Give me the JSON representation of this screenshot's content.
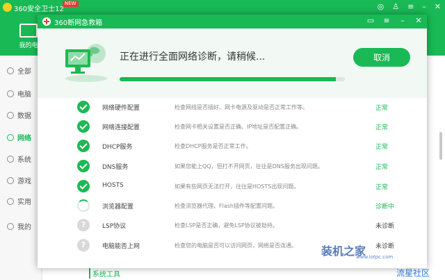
{
  "app": {
    "title": "360安全卫士12",
    "new_badge": "NEW",
    "top_tab": "我的电",
    "sidebar": [
      {
        "label": "全部"
      },
      {
        "label": "电脑"
      },
      {
        "label": "数据"
      },
      {
        "label": "网络"
      },
      {
        "label": "系统"
      },
      {
        "label": "游戏"
      },
      {
        "label": "实用"
      },
      {
        "label": "我的"
      }
    ],
    "bottom_section": "系统工具"
  },
  "dialog": {
    "title": "360断网急救箱",
    "status_text": "正在进行全面网络诊断，请稍候...",
    "progress": 0.96,
    "cancel_label": "取消",
    "rows": [
      {
        "name": "网络硬件配置",
        "desc": "检查网线是否插好、网卡电源及驱动是否正常工作等。",
        "result": "正常",
        "state": "ok"
      },
      {
        "name": "网络连接配置",
        "desc": "检查网卡相关设置是否正确、IP地址是否配置正确。",
        "result": "正常",
        "state": "ok"
      },
      {
        "name": "DHCP服务",
        "desc": "检查DHCP服务是否正常工作。",
        "result": "正常",
        "state": "ok"
      },
      {
        "name": "DNS服务",
        "desc": "如果您能上QQ，但打不开网页，往往是DNS服务出现问题。",
        "result": "正常",
        "state": "ok"
      },
      {
        "name": "HOSTS",
        "desc": "如果有些网页无法打开，往往是HOSTS出现问题。",
        "result": "正常",
        "state": "ok"
      },
      {
        "name": "浏览器配置",
        "desc": "检查浏览器代理、Flash插件等配置问题。",
        "result": "诊断中",
        "state": "loading"
      },
      {
        "name": "LSP协议",
        "desc": "检查LSP是否正确，避免LSP协议被劫持。",
        "result": "未诊断",
        "state": "pending"
      },
      {
        "name": "电脑能否上网",
        "desc": "检查您的电脑是否可以访问网页，网络是否连通。",
        "result": "未诊断",
        "state": "pending"
      }
    ]
  },
  "watermark": {
    "text": "装机之家",
    "url": "www.lotpc.com",
    "corner": "流星社区"
  }
}
